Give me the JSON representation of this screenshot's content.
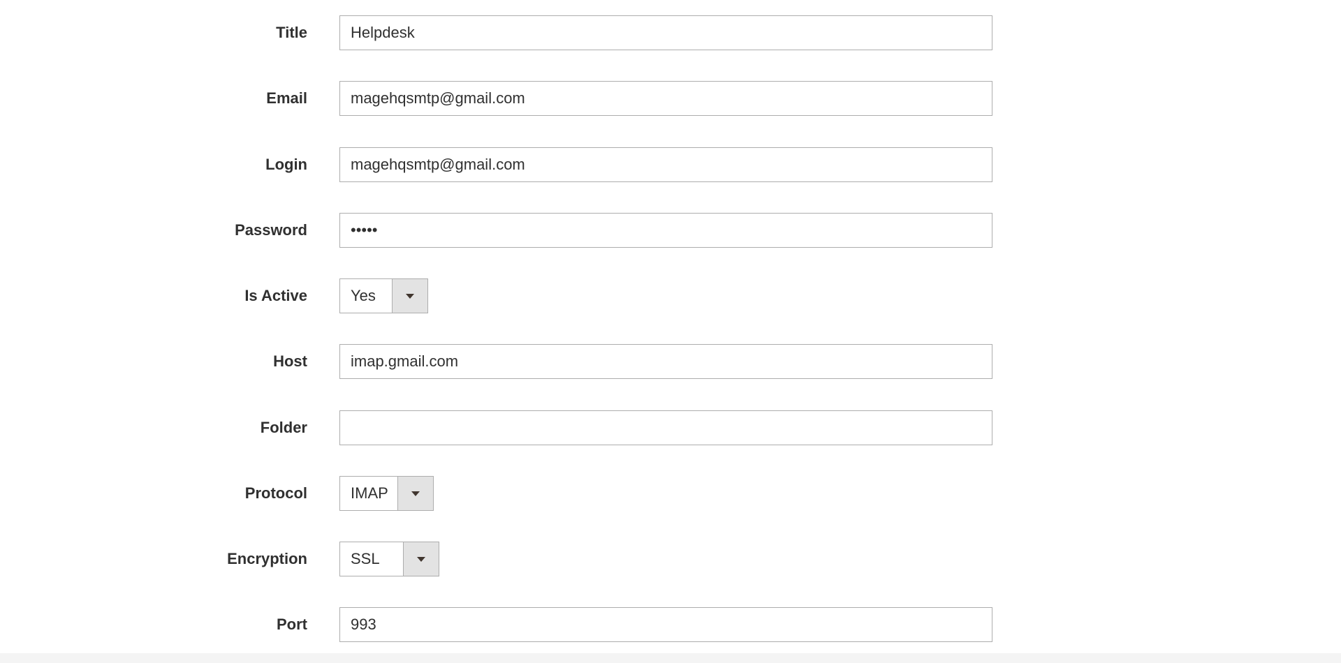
{
  "form": {
    "title": {
      "label": "Title",
      "value": "Helpdesk"
    },
    "email": {
      "label": "Email",
      "value": "magehqsmtp@gmail.com"
    },
    "login": {
      "label": "Login",
      "value": "magehqsmtp@gmail.com"
    },
    "password": {
      "label": "Password",
      "value": "•••••"
    },
    "is_active": {
      "label": "Is Active",
      "value": "Yes"
    },
    "host": {
      "label": "Host",
      "value": "imap.gmail.com"
    },
    "folder": {
      "label": "Folder",
      "value": ""
    },
    "protocol": {
      "label": "Protocol",
      "value": "IMAP"
    },
    "encryption": {
      "label": "Encryption",
      "value": "SSL"
    },
    "port": {
      "label": "Port",
      "value": "993"
    }
  }
}
